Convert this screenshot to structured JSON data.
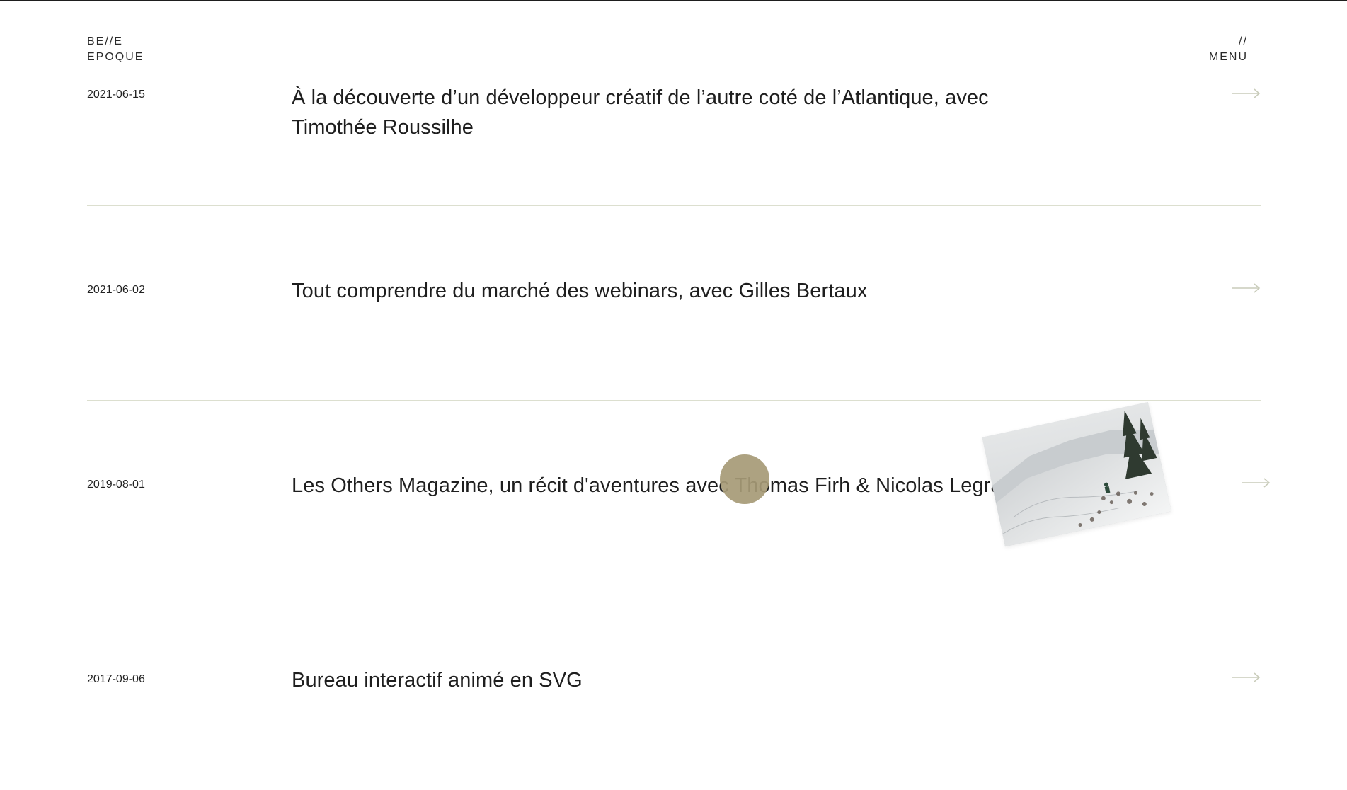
{
  "header": {
    "logo_line1": "BE//E",
    "logo_line2": "EPOQUE",
    "menu_slashes": "//",
    "menu_label": "MENU"
  },
  "articles": [
    {
      "date": "2021-06-15",
      "title": "À la découverte d’un développeur créatif de l’autre coté de l’Atlantique, avec Timothée Roussilhe"
    },
    {
      "date": "2021-06-02",
      "title": "Tout comprendre du marché des webinars, avec Gilles Bertaux"
    },
    {
      "date": "2019-08-01",
      "title": "Les Others Magazine, un récit d'aventures avec Thomas Firh & Nicolas Legras"
    },
    {
      "date": "2017-09-06",
      "title": "Bureau interactif animé en SVG"
    }
  ],
  "colors": {
    "divider": "#dcdfcf",
    "arrow": "#c9ccba",
    "cursor": "#a69a76"
  },
  "icons": {
    "arrow": "arrow-right-icon"
  }
}
